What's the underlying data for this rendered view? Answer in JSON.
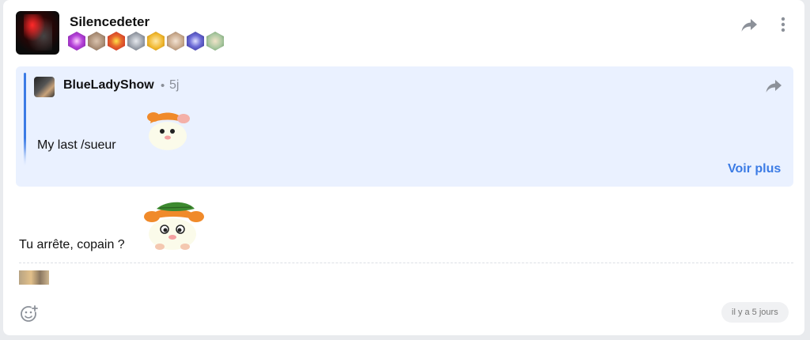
{
  "post": {
    "author": "Silencedeter",
    "badges": [
      {
        "name": "purple-swirl-badge",
        "color": "#b542d9"
      },
      {
        "name": "brown-creature-badge",
        "color": "#a68a72"
      },
      {
        "name": "red-yellow-badge",
        "color": "#d93a2b"
      },
      {
        "name": "grey-knight-badge",
        "color": "#9aa0aa"
      },
      {
        "name": "yellow-face-badge",
        "color": "#f0b72e"
      },
      {
        "name": "tan-creature-badge",
        "color": "#c8a98c"
      },
      {
        "name": "blue-moon-badge",
        "color": "#4b4ab8"
      },
      {
        "name": "green-character-badge",
        "color": "#8fb58a"
      }
    ],
    "message": "Tu arrête, copain ?",
    "relative_time": "il y a 5 jours"
  },
  "quote": {
    "author": "BlueLadyShow",
    "separator": "•",
    "age": "5j",
    "text": "My last /sueur",
    "see_more_label": "Voir plus"
  },
  "colors": {
    "accent": "#3b7be5",
    "quote_background": "#eaf1ff",
    "muted_text": "#8a8f98"
  },
  "icons": {
    "share": "share-arrow-icon",
    "more": "vertical-dots-icon",
    "react": "add-reaction-icon"
  }
}
